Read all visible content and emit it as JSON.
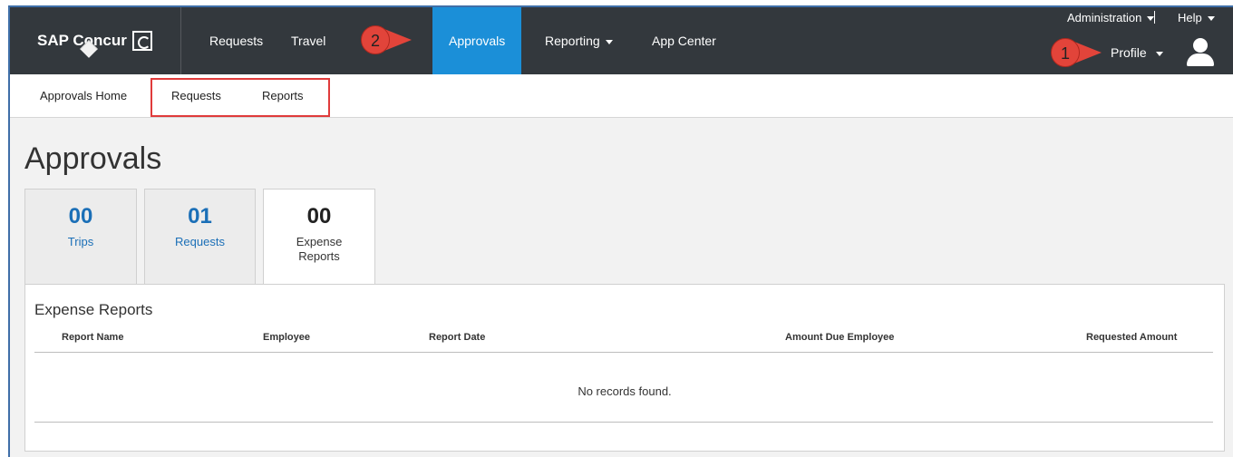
{
  "brand": {
    "name": "SAP Concur"
  },
  "nav": {
    "requests": "Requests",
    "travel": "Travel",
    "approvals": "Approvals",
    "reporting": "Reporting",
    "app_center": "App Center"
  },
  "utility": {
    "administration": "Administration",
    "help": "Help",
    "profile": "Profile"
  },
  "callouts": {
    "one": "1",
    "two": "2"
  },
  "subnav": {
    "home": "Approvals Home",
    "requests": "Requests",
    "reports": "Reports"
  },
  "page": {
    "title": "Approvals"
  },
  "tabs": [
    {
      "count": "00",
      "label": "Trips"
    },
    {
      "count": "01",
      "label": "Requests"
    },
    {
      "count": "00",
      "label_line1": "Expense",
      "label_line2": "Reports"
    }
  ],
  "panel": {
    "title": "Expense Reports",
    "columns": [
      "Report Name",
      "Employee",
      "Report Date",
      "Amount Due Employee",
      "Requested Amount"
    ],
    "empty_message": "No records found."
  },
  "colors": {
    "topbar": "#33383d",
    "active_nav": "#1b8fd8",
    "callout": "#e2443a",
    "highlight": "#e03b3b",
    "link": "#1b6fb7"
  }
}
